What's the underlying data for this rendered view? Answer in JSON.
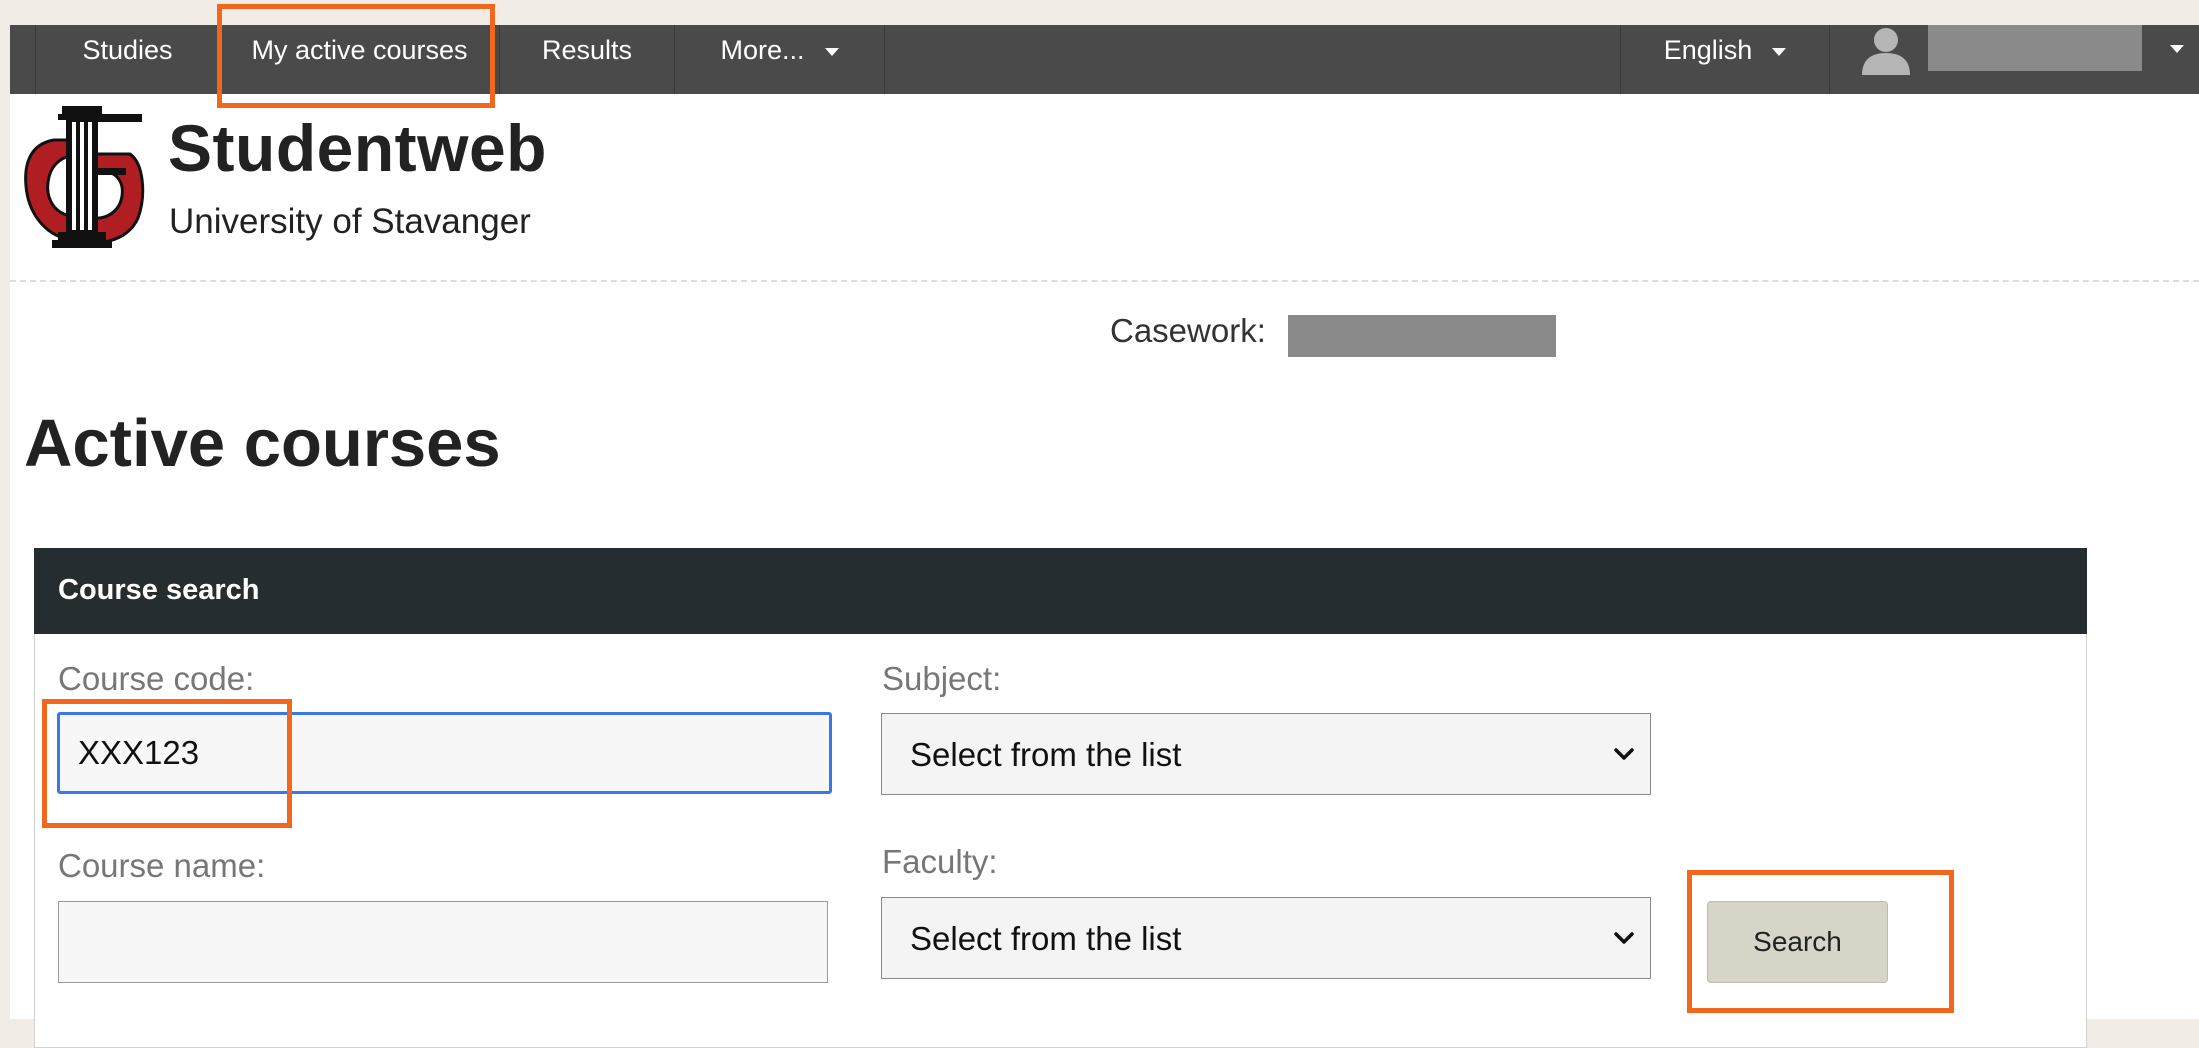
{
  "nav": {
    "items": [
      {
        "label": "Studies"
      },
      {
        "label": "My active courses"
      },
      {
        "label": "Results"
      },
      {
        "label": "More..."
      }
    ],
    "language": "English"
  },
  "header": {
    "app_name": "Studentweb",
    "institution": "University of Stavanger"
  },
  "casework": {
    "label": "Casework:"
  },
  "page_title": "Active courses",
  "search_panel": {
    "title": "Course search",
    "course_code": {
      "label": "Course code:",
      "value": "XXX123"
    },
    "course_name": {
      "label": "Course name:",
      "value": ""
    },
    "subject": {
      "label": "Subject:",
      "selected": "Select from the list"
    },
    "faculty": {
      "label": "Faculty:",
      "selected": "Select from the list"
    },
    "search_button": "Search"
  },
  "colors": {
    "nav_bg": "#4a4a4a",
    "panel_header_bg": "#262d30",
    "highlight": "#f2671e",
    "focus_ring": "#3b78e7",
    "button_bg": "#d6d5c8",
    "logo_red": "#b01e23"
  },
  "icons": {
    "user": "person-silhouette-icon",
    "dropdown": "caret-down-icon",
    "select": "chevron-down-icon"
  }
}
